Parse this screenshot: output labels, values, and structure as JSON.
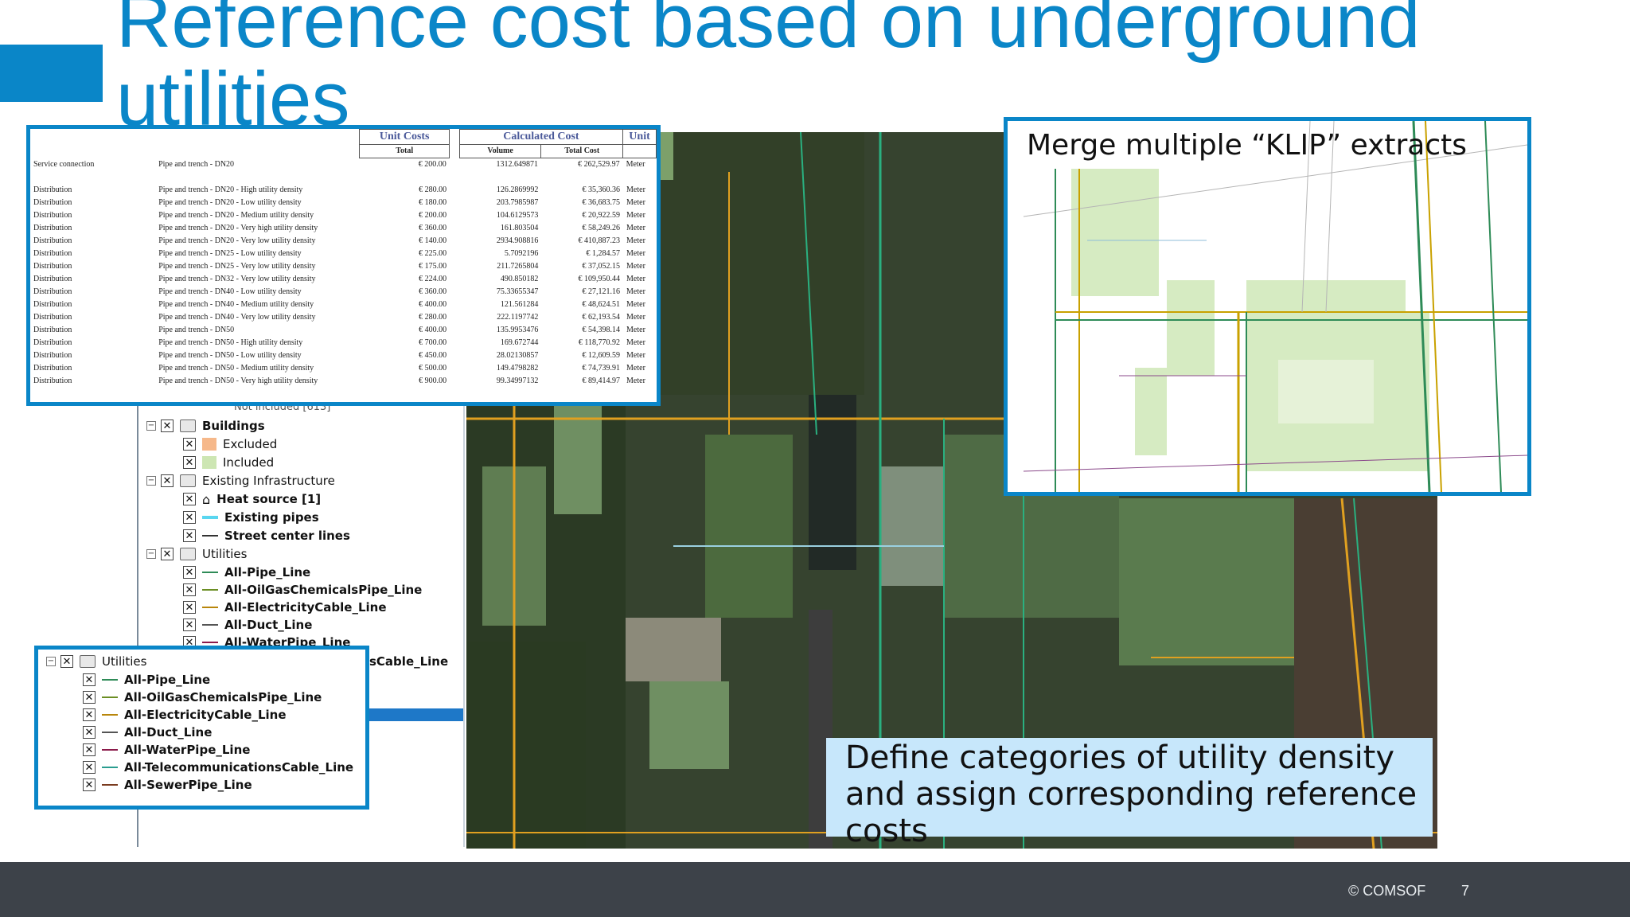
{
  "slide": {
    "title": "Reference cost based on underground utilities",
    "footer_copyright": "© COMSOF",
    "page_number": "7",
    "colors": {
      "accent": "#0a86c8",
      "footer": "#3d4249",
      "caption_bg": "#c7e7fb"
    }
  },
  "cost_table": {
    "headers": {
      "unit_costs": "Unit Costs",
      "calculated_cost": "Calculated Cost",
      "unit": "Unit",
      "total": "Total",
      "volume": "Volume",
      "total_cost": "Total Cost"
    },
    "service_row": {
      "category": "Service connection",
      "item": "Pipe and trench - DN20",
      "unit_cost": "€ 200.00",
      "volume": "1312.649871",
      "total_cost": "€ 262,529.97",
      "unit": "Meter"
    },
    "rows": [
      {
        "category": "Distribution",
        "item": "Pipe and trench - DN20 - High utility density",
        "unit_cost": "€ 280.00",
        "volume": "126.2869992",
        "total_cost": "€ 35,360.36",
        "unit": "Meter"
      },
      {
        "category": "Distribution",
        "item": "Pipe and trench - DN20 - Low utility density",
        "unit_cost": "€ 180.00",
        "volume": "203.7985987",
        "total_cost": "€ 36,683.75",
        "unit": "Meter"
      },
      {
        "category": "Distribution",
        "item": "Pipe and trench - DN20 - Medium utility density",
        "unit_cost": "€ 200.00",
        "volume": "104.6129573",
        "total_cost": "€ 20,922.59",
        "unit": "Meter"
      },
      {
        "category": "Distribution",
        "item": "Pipe and trench - DN20 - Very high utility density",
        "unit_cost": "€ 360.00",
        "volume": "161.803504",
        "total_cost": "€ 58,249.26",
        "unit": "Meter"
      },
      {
        "category": "Distribution",
        "item": "Pipe and trench - DN20 - Very low utility density",
        "unit_cost": "€ 140.00",
        "volume": "2934.908816",
        "total_cost": "€ 410,887.23",
        "unit": "Meter"
      },
      {
        "category": "Distribution",
        "item": "Pipe and trench - DN25 - Low utility density",
        "unit_cost": "€ 225.00",
        "volume": "5.7092196",
        "total_cost": "€ 1,284.57",
        "unit": "Meter"
      },
      {
        "category": "Distribution",
        "item": "Pipe and trench - DN25 - Very low utility density",
        "unit_cost": "€ 175.00",
        "volume": "211.7265804",
        "total_cost": "€ 37,052.15",
        "unit": "Meter"
      },
      {
        "category": "Distribution",
        "item": "Pipe and trench - DN32 - Very low utility density",
        "unit_cost": "€ 224.00",
        "volume": "490.850182",
        "total_cost": "€ 109,950.44",
        "unit": "Meter"
      },
      {
        "category": "Distribution",
        "item": "Pipe and trench - DN40 - Low utility density",
        "unit_cost": "€ 360.00",
        "volume": "75.33655347",
        "total_cost": "€ 27,121.16",
        "unit": "Meter"
      },
      {
        "category": "Distribution",
        "item": "Pipe and trench - DN40 - Medium utility density",
        "unit_cost": "€ 400.00",
        "volume": "121.561284",
        "total_cost": "€ 48,624.51",
        "unit": "Meter"
      },
      {
        "category": "Distribution",
        "item": "Pipe and trench - DN40 - Very low utility density",
        "unit_cost": "€ 280.00",
        "volume": "222.1197742",
        "total_cost": "€ 62,193.54",
        "unit": "Meter"
      },
      {
        "category": "Distribution",
        "item": "Pipe and trench - DN50",
        "unit_cost": "€ 400.00",
        "volume": "135.9953476",
        "total_cost": "€ 54,398.14",
        "unit": "Meter"
      },
      {
        "category": "Distribution",
        "item": "Pipe and trench - DN50 - High utility density",
        "unit_cost": "€ 700.00",
        "volume": "169.672744",
        "total_cost": "€ 118,770.92",
        "unit": "Meter"
      },
      {
        "category": "Distribution",
        "item": "Pipe and trench - DN50 - Low utility density",
        "unit_cost": "€ 450.00",
        "volume": "28.02130857",
        "total_cost": "€ 12,609.59",
        "unit": "Meter"
      },
      {
        "category": "Distribution",
        "item": "Pipe and trench - DN50 - Medium utility density",
        "unit_cost": "€ 500.00",
        "volume": "149.4798282",
        "total_cost": "€ 74,739.91",
        "unit": "Meter"
      },
      {
        "category": "Distribution",
        "item": "Pipe and trench - DN50 - Very high utility density",
        "unit_cost": "€ 900.00",
        "volume": "99.34997132",
        "total_cost": "€ 89,414.97",
        "unit": "Meter"
      }
    ]
  },
  "layers_panel": {
    "partial_top": "Not included [613]",
    "buildings": {
      "label": "Buildings",
      "excluded": "Excluded",
      "included": "Included"
    },
    "existing": {
      "label": "Existing Infrastructure",
      "heat_source": "Heat source [1]",
      "existing_pipes": "Existing pipes",
      "street_center": "Street center lines"
    },
    "utilities": {
      "label": "Utilities",
      "items": [
        "All-Pipe_Line",
        "All-OilGasChemicalsPipe_Line",
        "All-ElectricityCable_Line",
        "All-Duct_Line",
        "All-WaterPipe_Line"
      ],
      "partial_item": "sCable_Line"
    }
  },
  "utilities_popup": {
    "label": "Utilities",
    "items": [
      {
        "name": "All-Pipe_Line",
        "color": "#2e8b57"
      },
      {
        "name": "All-OilGasChemicalsPipe_Line",
        "color": "#6b8e23"
      },
      {
        "name": "All-ElectricityCable_Line",
        "color": "#b8860b"
      },
      {
        "name": "All-Duct_Line",
        "color": "#555555"
      },
      {
        "name": "All-WaterPipe_Line",
        "color": "#8b1a4a"
      },
      {
        "name": "All-TelecommunicationsCable_Line",
        "color": "#2a9d8f"
      },
      {
        "name": "All-SewerPipe_Line",
        "color": "#7a3b1f"
      }
    ]
  },
  "klip_caption": "Merge multiple “KLIP” extracts",
  "density_caption": "Define categories of utility density and assign corresponding reference costs"
}
